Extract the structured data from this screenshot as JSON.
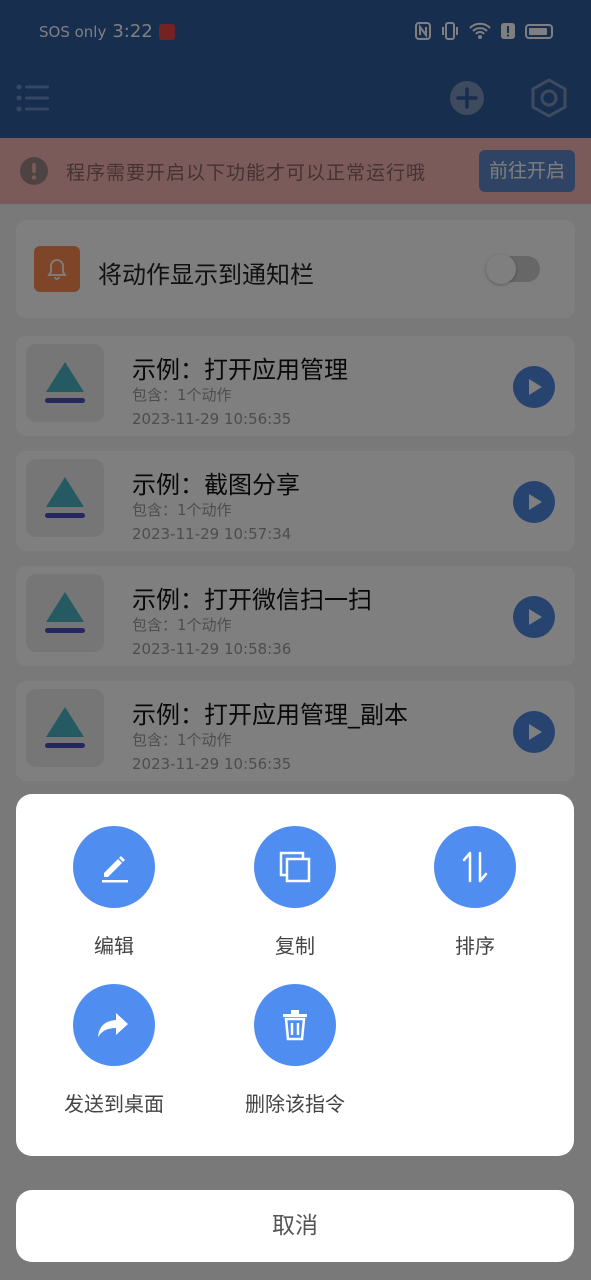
{
  "status_bar": {
    "carrier": "SOS only",
    "time": "3:22",
    "icons": [
      "nfc-icon",
      "vibrate-icon",
      "wifi-icon",
      "alert-icon",
      "battery-icon"
    ]
  },
  "toolbar": {
    "icons": [
      "menu-icon",
      "add-icon",
      "settings-icon"
    ]
  },
  "warning": {
    "text": "程序需要开启以下功能才可以正常运行哦",
    "button": "前往开启"
  },
  "notify_toggle": {
    "label": "将动作显示到通知栏",
    "on": false
  },
  "commands": [
    {
      "title": "示例：打开应用管理",
      "sub": "包含：1个动作",
      "date": "2023-11-29 10:56:35"
    },
    {
      "title": "示例：截图分享",
      "sub": "包含：1个动作",
      "date": "2023-11-29 10:57:34"
    },
    {
      "title": "示例：打开微信扫一扫",
      "sub": "包含：1个动作",
      "date": "2023-11-29 10:58:36"
    },
    {
      "title": "示例：打开应用管理_副本",
      "sub": "包含：1个动作",
      "date": "2023-11-29 10:56:35"
    }
  ],
  "actions": [
    {
      "label": "编辑",
      "icon": "edit-icon"
    },
    {
      "label": "复制",
      "icon": "copy-icon"
    },
    {
      "label": "排序",
      "icon": "sort-icon"
    },
    {
      "label": "发送到桌面",
      "icon": "share-icon"
    },
    {
      "label": "删除该指令",
      "icon": "trash-icon"
    }
  ],
  "cancel": "取消",
  "colors": {
    "primary": "#2e5c9e",
    "accent": "#4f8ef0",
    "warning_bg": "#f4b7b5",
    "overlay": "rgba(0,0,0,0.5)"
  }
}
